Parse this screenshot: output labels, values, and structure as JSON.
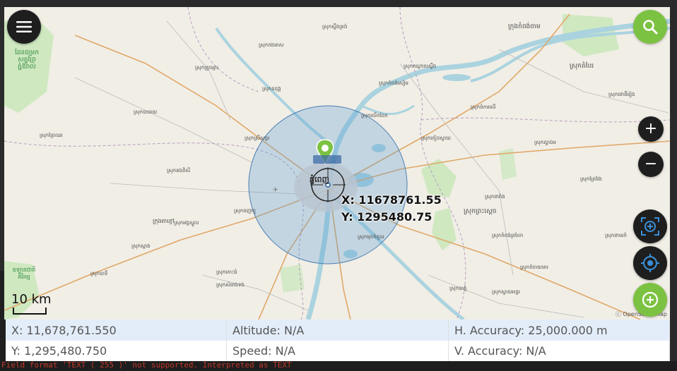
{
  "map": {
    "coord_x_label": "X: 11678761.55",
    "coord_y_label": "Y: 1295480.75",
    "scale_label": "10 km",
    "attribution": "ⓒ OpenStreetMap",
    "city_label": "ភ្នំពេញ",
    "places": [
      "ក្រុងកំពង់ចាម",
      "ស្រុកតំបែរ",
      "ស្រុកស្ទឹងត្រង់",
      "ស្រុកកងមាស",
      "ស្រុកក្រូចឆ្មារ",
      "ស្រុកបាធាយ",
      "ស្រុកព្រៃឈរ",
      "ស្រុកកំពង់សៀម",
      "ស្រុកចំការលើ",
      "ស្រុកស្រីសន្ធរ",
      "ស្រុកព្រៃវែង",
      "ស្រុកកៀនស្វាយ",
      "ស្រុកកណ្តាលស្ទឹង",
      "ស្រុកអង្គស្នួល",
      "ស្រុកពញាឮ",
      "ស្រុកឧដុង្គ",
      "ស្រុកលើកដែក",
      "ស្រុកល្វាឯម",
      "ស្រុកមុខកំពូល",
      "ស្រុកពារាំង",
      "ស្រុកព្រះស្ដេច",
      "ស្រុកកំចាយមារ",
      "ស្រុកបាភ្នំ",
      "ស្រុកស្វាយអន្ទរ",
      "ស្រុកស្អាង",
      "ស្រុកកោះធំ",
      "ស្រុកបាទី",
      "ក្រុងតាខ្មៅ",
      "ស្រុកកំពង់ត្របែក",
      "ស្រុកពោធិ៍រៀង",
      "ស្រុកពាមរក៍",
      "ស្រុកសំរោងទង",
      "ស្រុកគងពិសី"
    ],
    "green_labels": [
      "ដែនជម្រក សត្វព្រៃ ភ្នំឱរ៉ាល់",
      "ឧទ្យានជាតិ គិរីរម្យ"
    ]
  },
  "buttons": {
    "menu": "menu-button",
    "search": "search-button",
    "zoom_in": "+",
    "zoom_out": "−"
  },
  "info": {
    "x": "X: 11,678,761.550",
    "altitude": "Altitude: N/A",
    "h_accuracy": "H. Accuracy: 25,000.000 m",
    "y": "Y: 1,295,480.750",
    "speed": "Speed: N/A",
    "v_accuracy": "V. Accuracy: N/A"
  },
  "background_log": "Field format 'TEXT ( 255 )' not supported. Interpreted as TEXT",
  "colors": {
    "accent_green": "#7cc242",
    "button_dark": "#1e1e1e",
    "accuracy_circle": "#5b9bd5",
    "water": "#aad3df"
  }
}
